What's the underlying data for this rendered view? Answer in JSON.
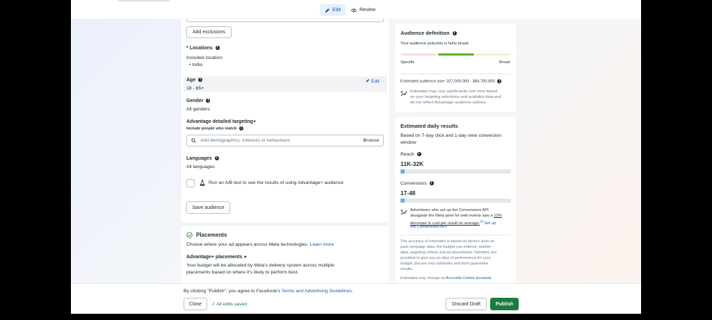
{
  "header": {
    "edit_label": "Edit",
    "review_label": "Review"
  },
  "audience": {
    "add_exclusions": "Add exclusions",
    "locations_label": "Locations",
    "required_marker": "*",
    "included_location_label": "Included location:",
    "location_value": "India",
    "age_label": "Age",
    "age_value": "18 - 65+",
    "age_edit": "Edit",
    "gender_label": "Gender",
    "gender_value": "All genders",
    "detailed_targeting_label": "Advantage detailed targeting",
    "detailed_targeting_plus": "+",
    "include_label": "Include people who match",
    "search_placeholder": "Add demographics, interests or behaviours",
    "browse": "Browse",
    "languages_label": "Languages",
    "languages_value": "All languages",
    "ab_test_text": "Run an A/B test to see the results of using Advantage+ audience",
    "save_audience": "Save audience"
  },
  "placements": {
    "title": "Placements",
    "description": "Choose where your ad appears across Meta technologies.",
    "learn_more": "Learn more",
    "advantage_label": "Advantage+ placements",
    "advantage_text_1": "Your budget will be allocated by Meta's delivery system across multiple",
    "advantage_text_2": "placements based on where it's likely to perform best."
  },
  "definition": {
    "title": "Audience definition",
    "status": "Your audience selection is fairly broad.",
    "specific": "Specific",
    "broad": "Broad",
    "size": "Estimated audience size: 327,000,000 - 384,700,000",
    "note_1": "Estimates may vary significantly over time based",
    "note_2": "on your targeting selections and available data and",
    "note_3": "do not reflect Advantage audience options.",
    "meter_level": 0.6
  },
  "results": {
    "title": "Estimated daily results",
    "basis_1": "Based on 7-day click and 1-day view conversion",
    "basis_2": "window",
    "reach_label": "Reach",
    "reach_value": "11K-32K",
    "reach_fill": 0.04,
    "conv_label": "Conversions",
    "conv_value": "17-48",
    "conv_fill": 0.04,
    "api_1": "Advertisers who set up the Conversions API",
    "api_2_pre": "alongside the Meta pixel for web events saw a",
    "api_2_link": "13%",
    "api_3_link": "decrease in cost per result on average.",
    "api_3_ref": "[1]",
    "api_3_post": "Set up",
    "api_4": "the Conversions API",
    "acc_1": "The accuracy of estimates is based on factors such as",
    "acc_2": "past campaign data, the budget you entered, market",
    "acc_3": "data, targeting criteria and ad placements. Numbers are",
    "acc_4": "provided to give you an idea of performance for your",
    "acc_5": "budget, but are only estimates and don't guarantee",
    "acc_6": "results.",
    "change_pre": "Estimates may change as",
    "change_link": "Accounts Centre accounts"
  },
  "footer": {
    "terms_pre": "By clicking \"Publish\", you agree to Facebook's",
    "terms_link": "Terms and Advertising Guidelines",
    "terms_post": ".",
    "close": "Close",
    "saved": "All edits saved",
    "discard": "Discard Draft",
    "publish": "Publish"
  },
  "colors": {
    "accent": "#0a5ac2",
    "publish": "#1a7a43",
    "meter_active": "#59b02c",
    "bar_fill": "#63b6dc"
  }
}
